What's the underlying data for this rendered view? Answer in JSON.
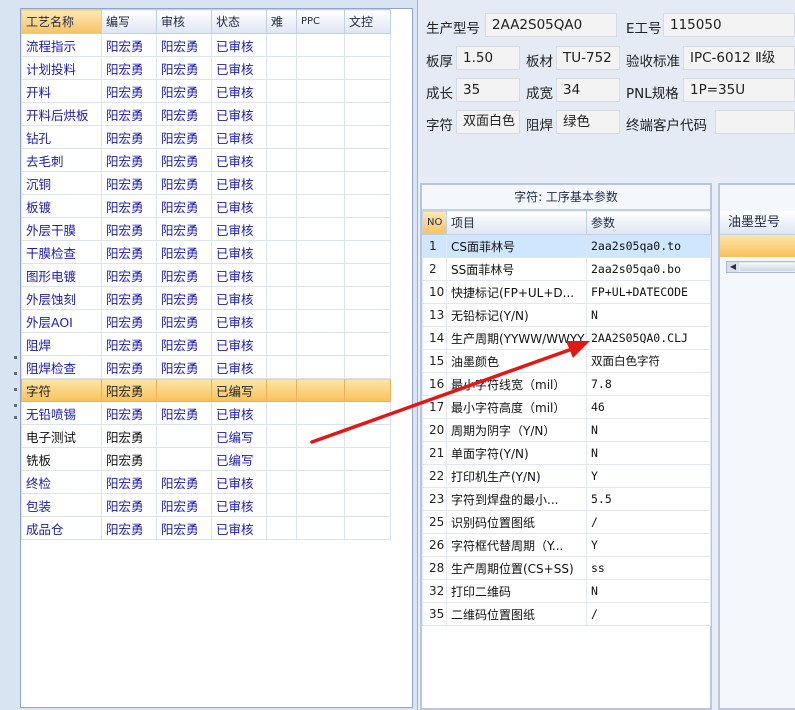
{
  "process_grid": {
    "columns": [
      "工艺名称",
      "编写",
      "审核",
      "状态",
      "难",
      "PPC",
      "文控"
    ],
    "rows": [
      {
        "name": "流程指示",
        "writer": "阳宏勇",
        "reviewer": "阳宏勇",
        "status": "已审核"
      },
      {
        "name": "计划投料",
        "writer": "阳宏勇",
        "reviewer": "阳宏勇",
        "status": "已审核"
      },
      {
        "name": "开料",
        "writer": "阳宏勇",
        "reviewer": "阳宏勇",
        "status": "已审核"
      },
      {
        "name": "开料后烘板",
        "writer": "阳宏勇",
        "reviewer": "阳宏勇",
        "status": "已审核"
      },
      {
        "name": "钻孔",
        "writer": "阳宏勇",
        "reviewer": "阳宏勇",
        "status": "已审核"
      },
      {
        "name": "去毛刺",
        "writer": "阳宏勇",
        "reviewer": "阳宏勇",
        "status": "已审核"
      },
      {
        "name": "沉铜",
        "writer": "阳宏勇",
        "reviewer": "阳宏勇",
        "status": "已审核"
      },
      {
        "name": "板镀",
        "writer": "阳宏勇",
        "reviewer": "阳宏勇",
        "status": "已审核"
      },
      {
        "name": "外层干膜",
        "writer": "阳宏勇",
        "reviewer": "阳宏勇",
        "status": "已审核"
      },
      {
        "name": "干膜检查",
        "writer": "阳宏勇",
        "reviewer": "阳宏勇",
        "status": "已审核"
      },
      {
        "name": "图形电镀",
        "writer": "阳宏勇",
        "reviewer": "阳宏勇",
        "status": "已审核"
      },
      {
        "name": "外层蚀刻",
        "writer": "阳宏勇",
        "reviewer": "阳宏勇",
        "status": "已审核"
      },
      {
        "name": "外层AOI",
        "writer": "阳宏勇",
        "reviewer": "阳宏勇",
        "status": "已审核"
      },
      {
        "name": "阻焊",
        "writer": "阳宏勇",
        "reviewer": "阳宏勇",
        "status": "已审核"
      },
      {
        "name": "阻焊检查",
        "writer": "阳宏勇",
        "reviewer": "阳宏勇",
        "status": "已审核"
      },
      {
        "name": "字符",
        "writer": "阳宏勇",
        "reviewer": "",
        "status": "已编写"
      },
      {
        "name": "无铅喷锡",
        "writer": "阳宏勇",
        "reviewer": "阳宏勇",
        "status": "已审核"
      },
      {
        "name": "电子测试",
        "writer": "阳宏勇",
        "reviewer": "",
        "status": "已编写"
      },
      {
        "name": "铣板",
        "writer": "阳宏勇",
        "reviewer": "",
        "status": "已编写"
      },
      {
        "name": "终检",
        "writer": "阳宏勇",
        "reviewer": "阳宏勇",
        "status": "已审核"
      },
      {
        "name": "包装",
        "writer": "阳宏勇",
        "reviewer": "阳宏勇",
        "status": "已审核"
      },
      {
        "name": "成品仓",
        "writer": "阳宏勇",
        "reviewer": "阳宏勇",
        "status": "已审核"
      }
    ]
  },
  "header_info": {
    "model_label": "生产型号",
    "model_value": "2AA2S05QA0",
    "eno_label": "E工号",
    "eno_value": "115050",
    "thickness_label": "板厚",
    "thickness_value": "1.50",
    "material_label": "板材",
    "material_value": "TU-752",
    "standard_label": "验收标准",
    "standard_value": "IPC-6012 Ⅱ级",
    "length_label": "成长",
    "length_value": "35",
    "width_label": "成宽",
    "width_value": "34",
    "pnl_label": "PNL规格",
    "pnl_value": "1P=35U",
    "char_label": "字符",
    "char_value": "双面白色",
    "mask_label": "阻焊",
    "mask_value": "绿色",
    "customer_label": "终端客户代码",
    "customer_value": ""
  },
  "params_panel": {
    "title": "字符: 工序基本参数",
    "col_no": "NO",
    "col_item": "项目",
    "col_param": "参数",
    "rows": [
      {
        "no": "1",
        "item": "CS面菲林号",
        "value": "2aa2s05qa0.to"
      },
      {
        "no": "2",
        "item": "SS面菲林号",
        "value": "2aa2s05qa0.bo"
      },
      {
        "no": "10",
        "item": "快捷标记(FP+UL+D...",
        "value": "FP+UL+DATECODE"
      },
      {
        "no": "13",
        "item": "无铅标记(Y/N)",
        "value": "N"
      },
      {
        "no": "14",
        "item": "生产周期(YYWW/WWYY)",
        "value": "2AA2S05QA0.CLJ"
      },
      {
        "no": "15",
        "item": "油墨颜色",
        "value": "双面白色字符"
      },
      {
        "no": "16",
        "item": "最小字符线宽（mil）",
        "value": "7.8"
      },
      {
        "no": "17",
        "item": "最小字符高度（mil）",
        "value": "46"
      },
      {
        "no": "20",
        "item": "周期为阴字（Y/N）",
        "value": "N"
      },
      {
        "no": "21",
        "item": "单面字符(Y/N)",
        "value": "N"
      },
      {
        "no": "22",
        "item": "打印机生产(Y/N)",
        "value": "Y"
      },
      {
        "no": "23",
        "item": "字符到焊盘的最小...",
        "value": "5.5"
      },
      {
        "no": "25",
        "item": "识别码位置图纸",
        "value": "/"
      },
      {
        "no": "26",
        "item": "字符框代替周期（Y...",
        "value": "Y"
      },
      {
        "no": "28",
        "item": "生产周期位置(CS+SS)",
        "value": "ss"
      },
      {
        "no": "32",
        "item": "打印二维码",
        "value": "N"
      },
      {
        "no": "35",
        "item": "二维码位置图纸",
        "value": "/"
      }
    ]
  },
  "ink_panel": {
    "header": "油墨型号"
  },
  "colors": {
    "selection": "#f8c15a",
    "link_text": "#1a1ab0",
    "arrow": "#e01818",
    "param_selection": "#cfe6ff"
  }
}
